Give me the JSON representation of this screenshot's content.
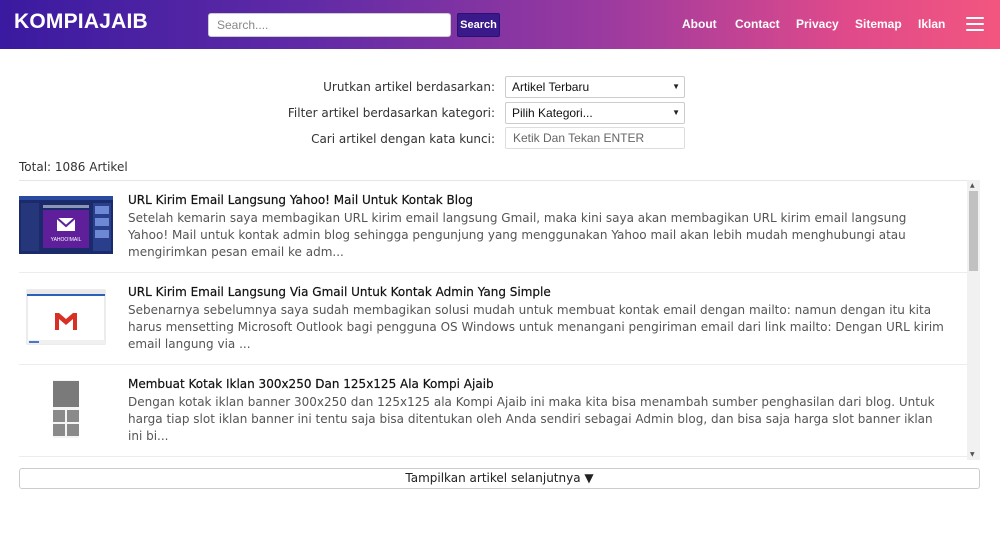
{
  "header": {
    "brand": "KOMPIAJAIB",
    "search_placeholder": "Search....",
    "search_button": "Search",
    "nav": [
      "About",
      "Contact",
      "Privacy",
      "Sitemap",
      "Iklan"
    ],
    "menu_icon": "hamburger-menu-icon"
  },
  "filters": {
    "sort_label": "Urutkan artikel berdasarkan:",
    "sort_value": "Artikel Terbaru",
    "category_label": "Filter artikel berdasarkan kategori:",
    "category_value": "Pilih Kategori...",
    "keyword_label": "Cari artikel dengan kata kunci:",
    "keyword_placeholder": "Ketik Dan Tekan ENTER"
  },
  "total": "Total: 1086 Artikel",
  "articles": [
    {
      "title": "URL Kirim Email Langsung Yahoo! Mail Untuk Kontak Blog",
      "description": "Setelah kemarin saya membagikan URL kirim email langsung Gmail, maka kini saya akan membagikan URL kirim email langsung Yahoo! Mail untuk kontak admin blog sehingga pengunjung yang menggunakan Yahoo mail akan lebih mudah menghubungi atau mengirimkan pesan email ke adm...",
      "thumb_label": "YAHOO!MAIL"
    },
    {
      "title": "URL Kirim Email Langsung Via Gmail Untuk Kontak Admin Yang Simple",
      "description": "Sebenarnya sebelumnya saya sudah membagikan solusi mudah untuk membuat kontak email dengan mailto: namun dengan itu kita harus mensetting Microsoft Outlook bagi pengguna OS Windows untuk menangani pengiriman email dari link mailto: Dengan URL kirim email langung via ..."
    },
    {
      "title": "Membuat Kotak Iklan 300x250 Dan 125x125 Ala Kompi Ajaib",
      "description": "Dengan kotak iklan banner 300x250 dan 125x125 ala Kompi Ajaib ini maka kita bisa menambah sumber penghasilan dari blog. Untuk harga tiap slot iklan banner ini tentu saja bisa ditentukan oleh Anda sendiri sebagai Admin blog, dan bisa saja harga slot banner iklan ini bi..."
    }
  ],
  "load_more": "Tampilkan artikel selanjutnya ▼",
  "colors": {
    "header_gradient_start": "#3a1aa0",
    "header_gradient_end": "#f2567f",
    "search_button": "#3a1a8a"
  }
}
